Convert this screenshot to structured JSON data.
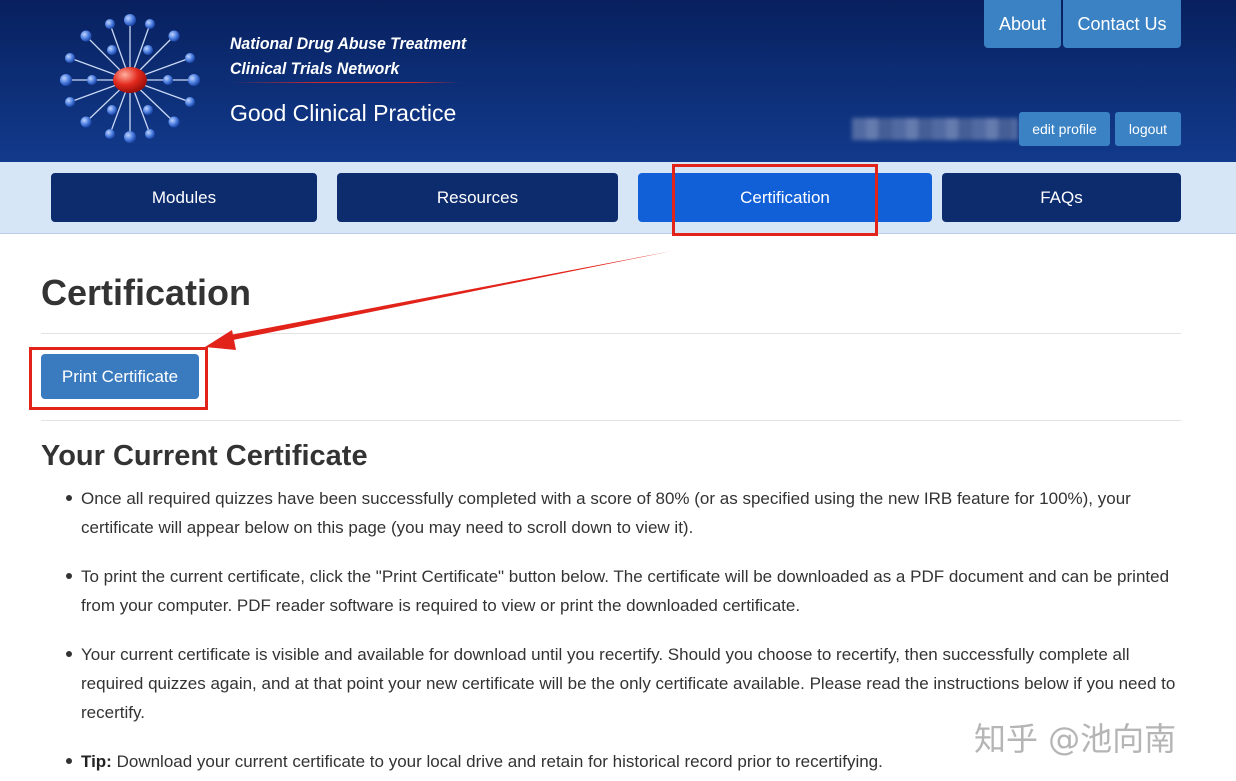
{
  "header": {
    "org_name_line1": "National Drug Abuse Treatment",
    "org_name_line2": "Clinical Trials Network",
    "site_title": "Good Clinical Practice",
    "top_links": [
      "About",
      "Contact Us"
    ],
    "edit_profile_label": "edit profile",
    "logout_label": "logout"
  },
  "nav": {
    "items": [
      {
        "label": "Modules"
      },
      {
        "label": "Resources"
      },
      {
        "label": "Certification",
        "active": true
      },
      {
        "label": "FAQs"
      }
    ]
  },
  "main": {
    "page_title": "Certification",
    "print_button_label": "Print Certificate",
    "section_title": "Your Current Certificate",
    "bullets": [
      {
        "text": "Once all required quizzes have been successfully completed with a score of 80% (or as specified using the new IRB feature for 100%), your certificate will appear below on this page (you may need to scroll down to view it)."
      },
      {
        "text": "To print the current certificate, click the \"Print Certificate\" button below. The certificate will be downloaded as a PDF document and can be printed from your computer. PDF reader software is required to view or print the downloaded certificate."
      },
      {
        "text": "Your current certificate is visible and available for download until you recertify. Should you choose to recertify, then successfully complete all required quizzes again, and at that point your new certificate will be the only certificate available. Please read the instructions below if you need to recertify."
      },
      {
        "prefix": "Tip:",
        "text": " Download your current certificate to your local drive and retain for historical record prior to recertifying."
      }
    ]
  },
  "watermark": "知乎 @池向南",
  "colors": {
    "header_bg": "#0d2f78",
    "nav_bg": "#d7e6f6",
    "nav_button": "#0c2c6e",
    "nav_active": "#1260d8",
    "action_button": "#3a7bbf",
    "annotation": "#e2231a"
  },
  "icons": {
    "logo": "network-molecule-logo",
    "annotation_arrow": "red-arrow"
  }
}
